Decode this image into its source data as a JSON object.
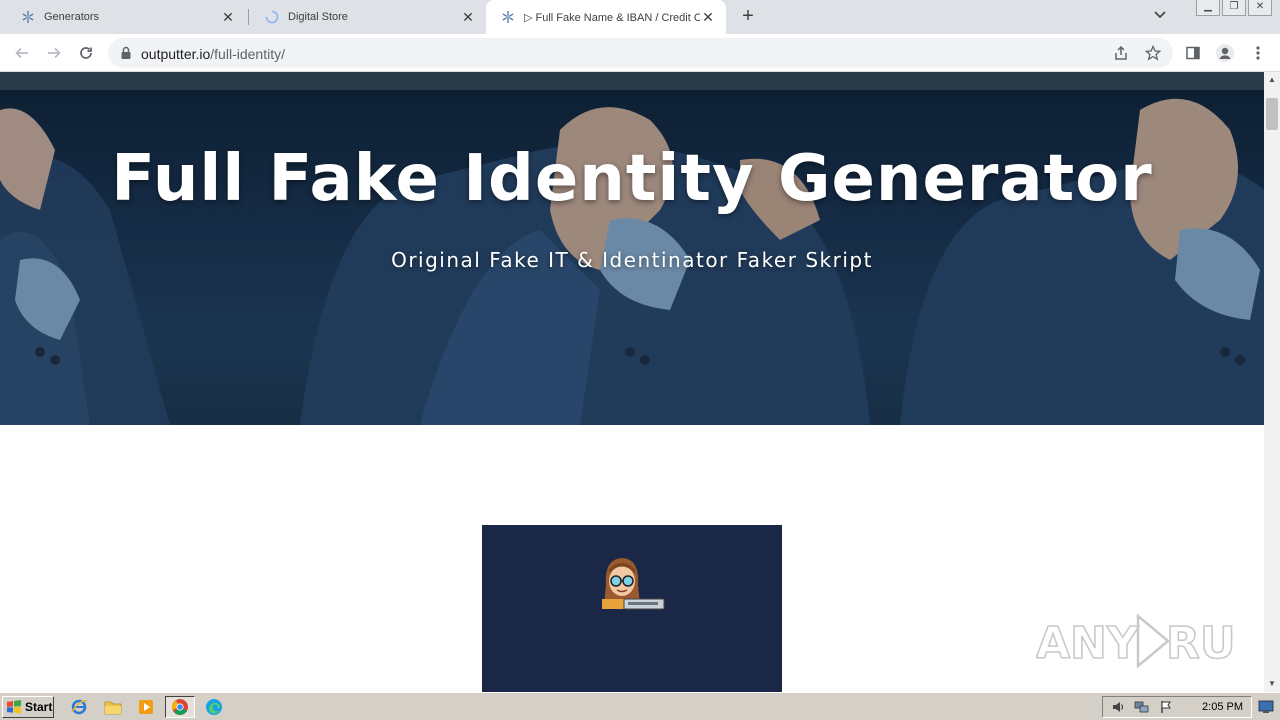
{
  "browser": {
    "tabs": [
      {
        "title": "Generators",
        "favicon": "snowflake-icon",
        "active": false
      },
      {
        "title": "Digital Store",
        "favicon": "loading-spinner-icon",
        "active": false
      },
      {
        "title": "▷ Full Fake Name & IBAN / Credit Ca",
        "favicon": "snowflake-icon",
        "active": true
      }
    ],
    "url_host": "outputter.io",
    "url_path": "/full-identity/"
  },
  "page": {
    "hero_title": "Full Fake Identity Generator",
    "hero_subtitle": "Original Fake IT & Identinator Faker Skript"
  },
  "watermark": "ANY RUN",
  "taskbar": {
    "start_label": "Start",
    "clock": "2:05 PM"
  },
  "colors": {
    "tabstrip": "#dee1e6",
    "hero_dark": "#0e2236",
    "promo_bg": "#1b2746",
    "taskbar": "#d4d0c8"
  }
}
